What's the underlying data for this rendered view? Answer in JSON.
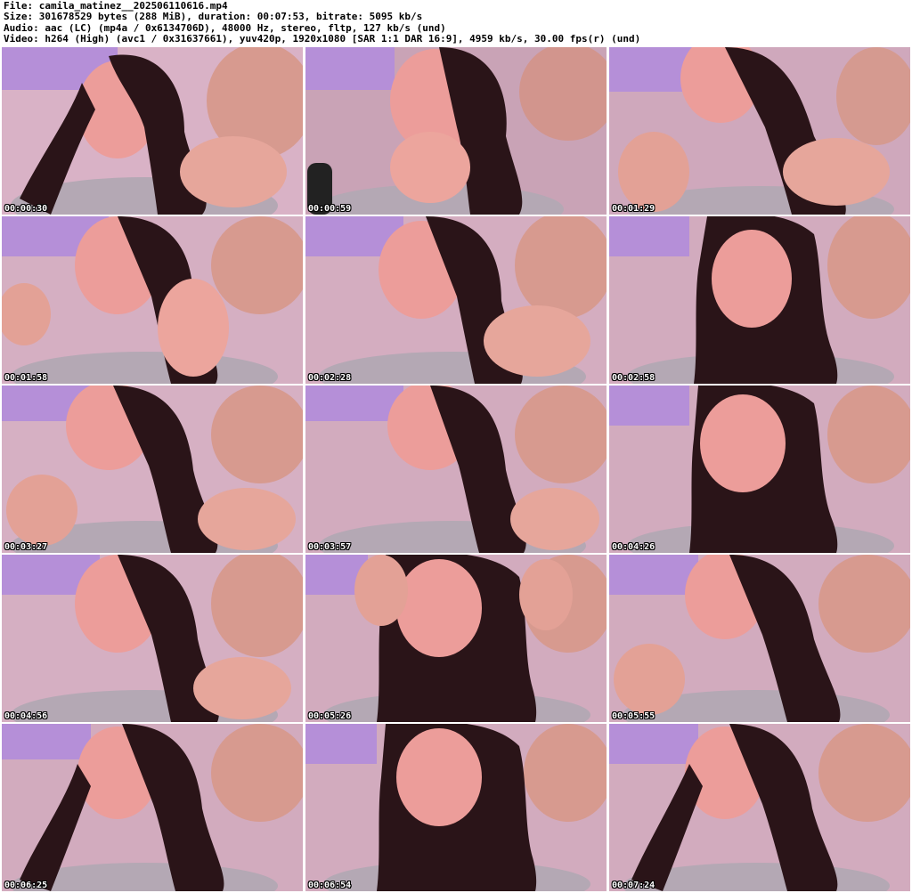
{
  "header": {
    "file_line": "File: camila_matinez__202506110616.mp4",
    "size_line": "Size: 301678529 bytes (288 MiB), duration: 00:07:53, bitrate: 5095 kb/s",
    "audio_line": "Audio: aac (LC) (mp4a / 0x6134706D), 48000 Hz, stereo, fltp, 127 kb/s (und)",
    "video_line": "Video: h264 (High) (avc1 / 0x31637661), yuv420p, 1920x1080 [SAR 1:1 DAR 16:9], 4959 kb/s, 30.00 fps(r) (und)"
  },
  "thumbnails": [
    {
      "timestamp": "00:00:30"
    },
    {
      "timestamp": "00:00:59"
    },
    {
      "timestamp": "00:01:29"
    },
    {
      "timestamp": "00:01:58"
    },
    {
      "timestamp": "00:02:28"
    },
    {
      "timestamp": "00:02:58"
    },
    {
      "timestamp": "00:03:27"
    },
    {
      "timestamp": "00:03:57"
    },
    {
      "timestamp": "00:04:26"
    },
    {
      "timestamp": "00:04:56"
    },
    {
      "timestamp": "00:05:26"
    },
    {
      "timestamp": "00:05:55"
    },
    {
      "timestamp": "00:06:25"
    },
    {
      "timestamp": "00:06:54"
    },
    {
      "timestamp": "00:07:24"
    }
  ],
  "colors": {
    "background": "#ffffff",
    "wall_purple": "#b58fd8",
    "skin": "#e8a49a",
    "hair": "#2a1418",
    "pillow": "#b4a8b4",
    "timestamp_text": "#ffffff"
  }
}
